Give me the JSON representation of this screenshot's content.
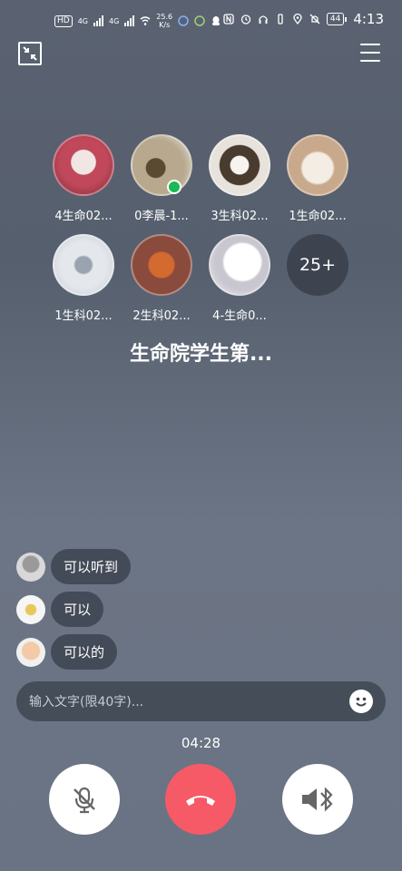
{
  "status_bar": {
    "hd_label": "HD",
    "net1": "4G",
    "net2": "4G",
    "speed_value": "25.6",
    "speed_unit": "K/s",
    "battery": "44",
    "time": "4:13"
  },
  "members": [
    {
      "name": "4生命02...",
      "avatar_color": "#c0485a"
    },
    {
      "name": "0李晨-1...",
      "avatar_color": "#b8a98e",
      "speaking": true
    },
    {
      "name": "3生科02...",
      "avatar_color": "#e7e2dc"
    },
    {
      "name": "1生命02...",
      "avatar_color": "#c9a98c"
    },
    {
      "name": "1生科02...",
      "avatar_color": "#c8cdd6"
    },
    {
      "name": "2生科02...",
      "avatar_color": "#8a4a3c"
    },
    {
      "name": "4-生命0...",
      "avatar_color": "#f2f0f3"
    }
  ],
  "more_count": "25+",
  "group_title": "生命院学生第...",
  "messages": [
    {
      "text": "可以听到"
    },
    {
      "text": "可以"
    },
    {
      "text": "可以的"
    }
  ],
  "input": {
    "placeholder": "输入文字(限40字)..."
  },
  "call_timer": "04:28",
  "accent_colors": {
    "hangup": "#f65a66",
    "speaking": "#19b955"
  }
}
